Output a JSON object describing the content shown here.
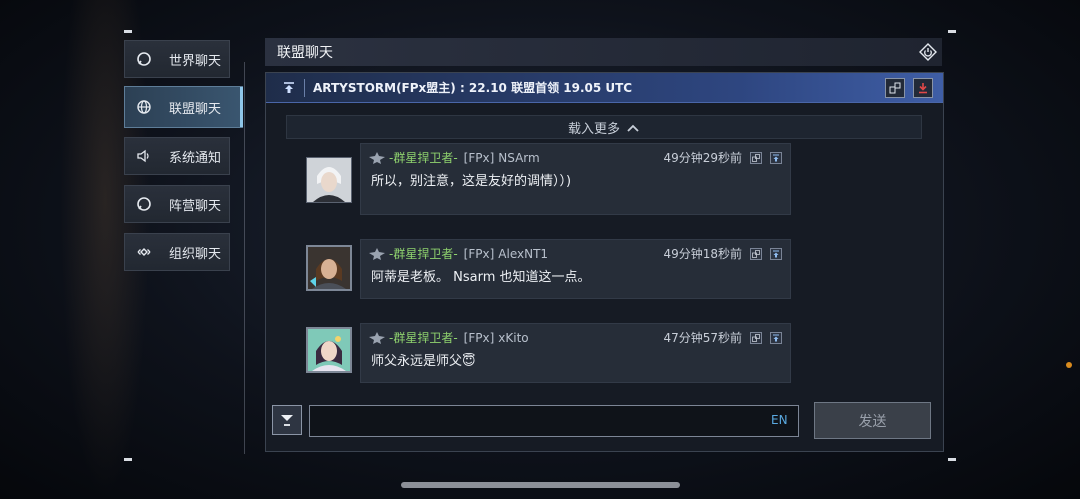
{
  "sidebar": {
    "items": [
      {
        "label": "世界聊天",
        "icon": "chat-bubble-icon"
      },
      {
        "label": "联盟聊天",
        "icon": "globe-icon",
        "active": true
      },
      {
        "label": "系统通知",
        "icon": "speaker-icon"
      },
      {
        "label": "阵营聊天",
        "icon": "chat-bubble-icon"
      },
      {
        "label": "组织聊天",
        "icon": "diamond-link-icon"
      }
    ]
  },
  "header": {
    "title": "联盟聊天",
    "icon": "power-icon"
  },
  "pinned": {
    "text": "ARTYSTORM(FPx盟主) : 22.10 联盟首领 19.05 UTC"
  },
  "load_more": {
    "label": "载入更多"
  },
  "messages": [
    {
      "guild": "-群星捍卫者-",
      "tag": "[FPx]",
      "name": "NSArm",
      "time": "49分钟29秒前",
      "text": "所以，别注意，这是友好的调情））)"
    },
    {
      "guild": "-群星捍卫者-",
      "tag": "[FPx]",
      "name": "AlexNT1",
      "time": "49分钟18秒前",
      "text": "阿蒂是老板。 Nsarm 也知道这一点。"
    },
    {
      "guild": "-群星捍卫者-",
      "tag": "[FPx]",
      "name": "xKito",
      "time": "47分钟57秒前",
      "text": "师父永远是师父😇"
    }
  ],
  "input": {
    "value": "",
    "lang": "EN"
  },
  "send": {
    "label": "发送"
  },
  "colors": {
    "accent": "#8fc7ea",
    "guild_name": "#8fd26e",
    "pinned_bar": "#3f5ea6",
    "export_icon": "#d94040"
  }
}
